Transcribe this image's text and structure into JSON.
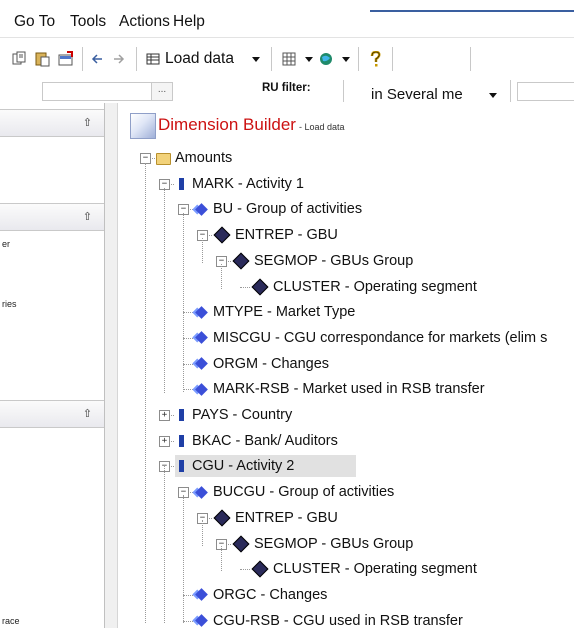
{
  "menu": {
    "items": [
      "Go To",
      "Tools",
      "Actions",
      "Help"
    ]
  },
  "toolbar": {
    "load_data_label": "Load data"
  },
  "filterbar": {
    "ellipsis_label": "...",
    "ru_filter_label": "RU filter:",
    "ru_filter_value": "in Several me"
  },
  "left_pane": {
    "section_texts": [
      "er",
      "ries",
      "race"
    ]
  },
  "header": {
    "title": "Dimension Builder",
    "subtitle": "- Load data"
  },
  "tree": {
    "rows": [
      {
        "label": "Amounts"
      },
      {
        "label": "MARK - Activity 1"
      },
      {
        "label": "BU - Group of activities"
      },
      {
        "label": "ENTREP - GBU"
      },
      {
        "label": "SEGMOP - GBUs Group"
      },
      {
        "label": "CLUSTER - Operating segment"
      },
      {
        "label": "MTYPE - Market Type"
      },
      {
        "label": "MISCGU - CGU correspondance for markets (elim s"
      },
      {
        "label": "ORGM - Changes"
      },
      {
        "label": "MARK-RSB - Market used in RSB transfer"
      },
      {
        "label": "PAYS - Country"
      },
      {
        "label": "BKAC - Bank/ Auditors"
      },
      {
        "label": "CGU - Activity 2"
      },
      {
        "label": "BUCGU - Group of activities"
      },
      {
        "label": "ENTREP - GBU"
      },
      {
        "label": "SEGMOP - GBUs Group"
      },
      {
        "label": "CLUSTER - Operating segment"
      },
      {
        "label": "ORGC - Changes"
      },
      {
        "label": "CGU-RSB - CGU used in RSB transfer"
      }
    ]
  }
}
